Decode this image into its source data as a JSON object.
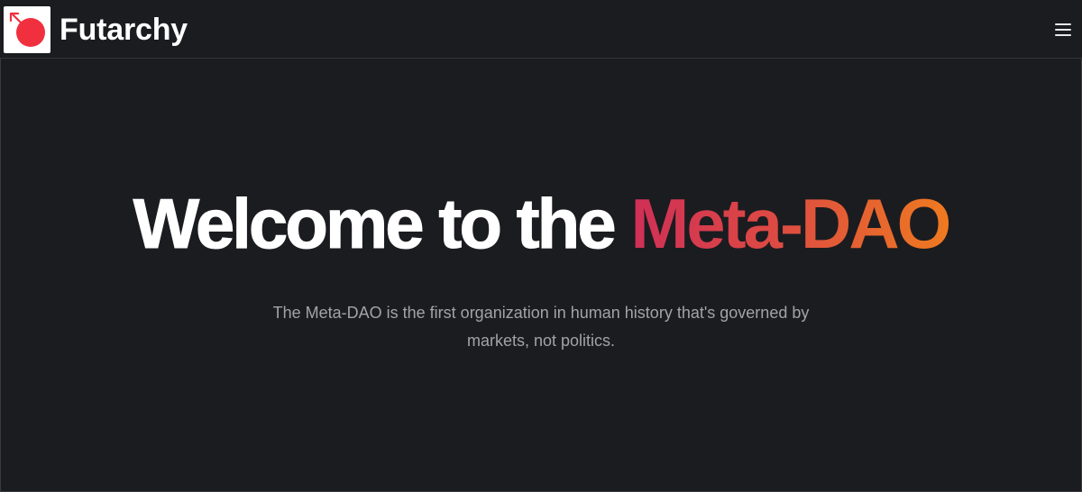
{
  "header": {
    "logo_icon": "futarchy-logo-icon",
    "brand_name": "Futarchy",
    "menu_icon": "hamburger-menu-icon"
  },
  "hero": {
    "title_plain": "Welcome to the",
    "title_accent": "Meta-DAO",
    "subtitle": "The Meta-DAO is the first organization in human history that's governed by markets, not politics."
  },
  "colors": {
    "background": "#1b1c20",
    "logo_red": "#f0303e",
    "accent_gradient_start": "#cf2f57",
    "accent_gradient_end": "#ee7a20",
    "subtitle_text": "#a2a3a8"
  }
}
